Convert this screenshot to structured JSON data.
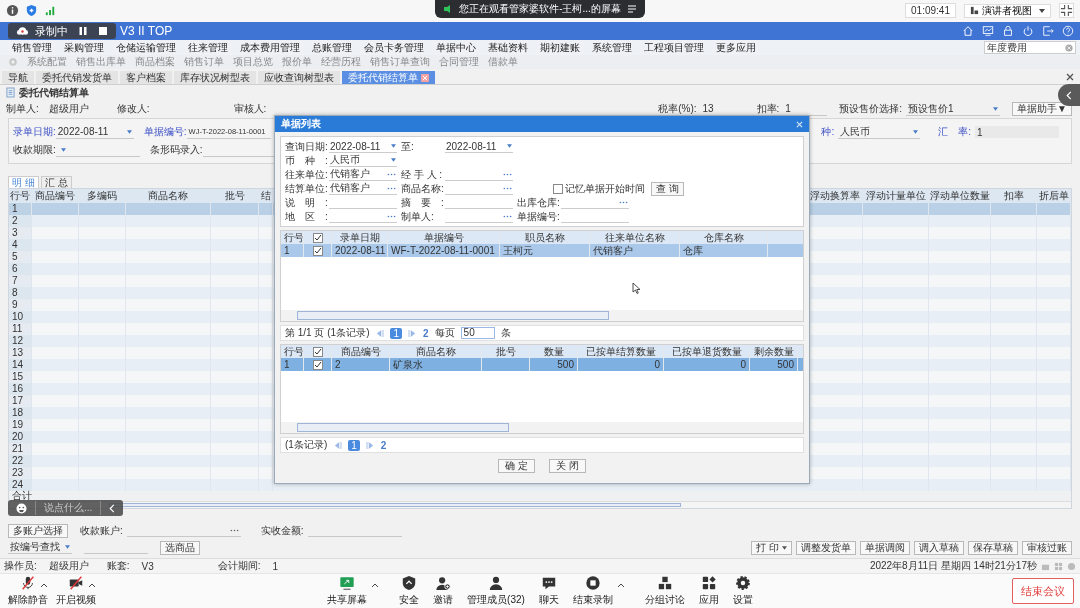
{
  "meeting": {
    "share_notice": "您正在观看管家婆软件-王柯...的屏幕",
    "time": "01:09:41",
    "view_button": "演讲者视图"
  },
  "recording": {
    "label": "录制中"
  },
  "app": {
    "title": "V3 II TOP"
  },
  "menu": [
    "销售管理",
    "采购管理",
    "仓储运输管理",
    "往来管理",
    "成本费用管理",
    "总账管理",
    "会员卡务管理",
    "单据中心",
    "基础资料",
    "期初建账",
    "系统管理",
    "工程项目管理",
    "更多应用"
  ],
  "search": {
    "value": "年度费用"
  },
  "shortcuts": [
    "系统配置",
    "销售出库单",
    "商品档案",
    "销售订单",
    "项目总览",
    "报价单",
    "经营历程",
    "销售订单查询",
    "合同管理",
    "借款单"
  ],
  "tabs": [
    {
      "label": "导航",
      "selected": false,
      "closable": false
    },
    {
      "label": "委托代销发货单",
      "selected": false,
      "closable": false
    },
    {
      "label": "客户档案",
      "selected": false,
      "closable": false
    },
    {
      "label": "库存状况树型表",
      "selected": false,
      "closable": false
    },
    {
      "label": "应收查询树型表",
      "selected": false,
      "closable": false
    },
    {
      "label": "委托代销结算单",
      "selected": true,
      "closable": true
    }
  ],
  "document": {
    "title": "委托代销结算单",
    "creator_label": "制单人:",
    "creator": "超级用户",
    "modifier_label": "修改人:",
    "auditor_label": "审核人:",
    "tax_label": "税率(%):",
    "tax": "13",
    "discount_label": "扣率:",
    "discount": "1",
    "price_label": "预设售价选择:",
    "price": "预设售价1",
    "helper_button": "单据助手▼"
  },
  "form": {
    "date_label": "录单日期:",
    "date": "2022-08-11",
    "number_label": "单据编号:",
    "number": "WJ-T-2022-08-11-0001",
    "term_label": "收款期限:",
    "barcode_label": "条形码录入:",
    "currency_label": "种:",
    "currency": "人民币",
    "rate_label": "汇　率:",
    "rate": "1"
  },
  "detail_tabs": [
    {
      "label": "明 细",
      "selected": true
    },
    {
      "label": "汇 总",
      "selected": false
    }
  ],
  "grid": {
    "columns_left": [
      "行号",
      "商品编号",
      "多编码",
      "商品名称",
      "批号",
      "结"
    ],
    "columns_right": [
      "浮动换算率",
      "浮动计量单位",
      "浮动单位数量",
      "扣率",
      "折后单"
    ],
    "rows": [
      {
        "no": "1",
        "selected": true
      },
      {
        "no": "2",
        "selected": false
      },
      {
        "no": "3",
        "selected": false
      },
      {
        "no": "4",
        "selected": false
      },
      {
        "no": "5",
        "selected": false
      },
      {
        "no": "6",
        "selected": false
      },
      {
        "no": "7",
        "selected": false
      },
      {
        "no": "8",
        "selected": false
      },
      {
        "no": "9",
        "selected": false
      },
      {
        "no": "10",
        "selected": false
      },
      {
        "no": "11",
        "selected": false
      },
      {
        "no": "12",
        "selected": false
      },
      {
        "no": "13",
        "selected": false
      },
      {
        "no": "14",
        "selected": false
      },
      {
        "no": "15",
        "selected": false
      },
      {
        "no": "16",
        "selected": false
      },
      {
        "no": "17",
        "selected": false
      },
      {
        "no": "18",
        "selected": false
      },
      {
        "no": "19",
        "selected": false
      },
      {
        "no": "20",
        "selected": false
      },
      {
        "no": "21",
        "selected": false
      },
      {
        "no": "22",
        "selected": false
      },
      {
        "no": "23",
        "selected": false
      },
      {
        "no": "24",
        "selected": false
      }
    ],
    "total_label": "合计"
  },
  "payment": {
    "multi_button": "多账户选择",
    "account_label": "收款账户:",
    "amount_label": "实收金额:"
  },
  "finder": {
    "mode": "按编号查找",
    "select_button": "选商品"
  },
  "actions": {
    "print_button": "打 印",
    "buttons": [
      "调整发货单",
      "单据调阅",
      "调入草稿",
      "保存草稿",
      "审核过账"
    ]
  },
  "status_bar": {
    "operator_label": "操作员:",
    "operator": "超级用户",
    "book_label": "账套:",
    "book": "V3",
    "period_label": "会计期间:",
    "period": "1",
    "datetime": "2022年8月11日 星期四 14时21分17秒"
  },
  "dialog": {
    "title": "单据列表",
    "filters": [
      [
        {
          "kind": "date",
          "label": "查询日期:",
          "value": "2022-08-11"
        },
        {
          "kind": "date",
          "label": "至:",
          "value": "2022-08-11"
        }
      ],
      [
        {
          "kind": "select",
          "label": "币　种　:",
          "value": "人民币"
        }
      ],
      [
        {
          "kind": "lookup",
          "label": "往来单位:",
          "value": "代销客户"
        },
        {
          "kind": "lookup",
          "label": "经 手 人 :"
        }
      ],
      [
        {
          "kind": "lookup",
          "label": "结算单位:",
          "value": "代销客户"
        },
        {
          "kind": "lookup",
          "label": "商品名称:"
        },
        {
          "kind": "checkbox",
          "label": "记忆单据开始时间",
          "checked": false
        },
        {
          "kind": "button",
          "label": "查 询"
        }
      ],
      [
        {
          "kind": "text",
          "label": "说　明　:"
        },
        {
          "kind": "text",
          "label": "摘　要　:"
        },
        {
          "kind": "lookup",
          "label": "出库仓库:"
        }
      ],
      [
        {
          "kind": "lookup",
          "label": "地　区　:"
        },
        {
          "kind": "lookup",
          "label": "制单人:"
        },
        {
          "kind": "text",
          "label": "单据编号:"
        }
      ]
    ],
    "list": {
      "columns": [
        "行号",
        "录单日期",
        "单据编号",
        "职员名称",
        "往来单位名称",
        "仓库名称"
      ],
      "header_checked": true,
      "rows": [
        {
          "cells": [
            "1",
            "2022-08-11",
            "WF-T-2022-08-11-0001",
            "王柯元",
            "代销客户",
            "仓库"
          ],
          "checked": true,
          "selected": true
        }
      ],
      "pager": {
        "summary": "第 1/1 页 (1条记录)",
        "pages": [
          {
            "label": "1",
            "selected": true
          }
        ],
        "extra": "2",
        "per_page_label": "每页",
        "per_page": "50",
        "unit": "条"
      }
    },
    "items": {
      "columns": [
        "行号",
        "商品编号",
        "商品名称",
        "批号",
        "数量",
        "已按单结算数量",
        "已按单退货数量",
        "剩余数量"
      ],
      "header_checked": true,
      "rows": [
        {
          "cells": [
            "1",
            "2",
            "矿泉水",
            "",
            "500",
            "0",
            "0",
            "500"
          ],
          "checked": true,
          "selected": true
        }
      ],
      "pager": {
        "summary": "(1条记录)",
        "pages": [
          {
            "label": "1",
            "selected": true
          }
        ],
        "extra": "2"
      }
    },
    "ok_button": "确 定",
    "close_button": "关 闭"
  },
  "chat": {
    "placeholder": "说点什么..."
  },
  "toolbar": {
    "items": [
      {
        "kind": "mic-off",
        "label": "解除静音",
        "caret": true
      },
      {
        "kind": "video-off",
        "label": "开启视频",
        "caret": true
      },
      {
        "kind": "share",
        "label": "共享屏幕",
        "caret": true
      },
      {
        "kind": "shield",
        "label": "安全",
        "caret": false
      },
      {
        "kind": "invite",
        "label": "邀请",
        "caret": false
      },
      {
        "kind": "members",
        "label": "管理成员(32)",
        "caret": false
      },
      {
        "kind": "chat",
        "label": "聊天",
        "caret": false
      },
      {
        "kind": "record",
        "label": "结束录制",
        "caret": true
      },
      {
        "kind": "groups",
        "label": "分组讨论",
        "caret": false
      },
      {
        "kind": "apps",
        "label": "应用",
        "caret": false
      },
      {
        "kind": "settings",
        "label": "设置",
        "caret": false
      }
    ],
    "end_button": "结束会议"
  }
}
